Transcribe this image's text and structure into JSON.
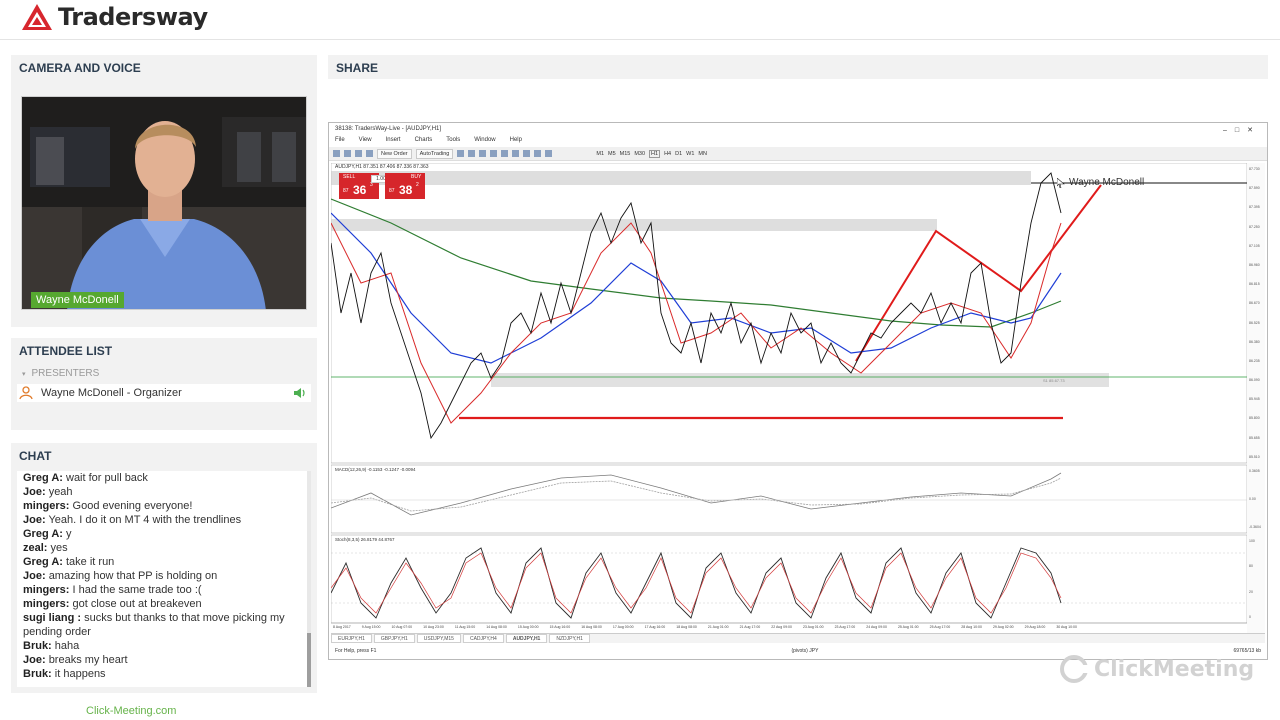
{
  "header": {
    "logo_text": "Tradersway"
  },
  "camera": {
    "title": "CAMERA AND VOICE",
    "presenter_name": "Wayne McDonell"
  },
  "attendees": {
    "title": "ATTENDEE LIST",
    "group_label": "PRESENTERS",
    "items": [
      {
        "name": "Wayne McDonell - Organizer"
      }
    ]
  },
  "chat": {
    "title": "CHAT",
    "messages": [
      {
        "author": "Greg A:",
        "text": "wait for pull back"
      },
      {
        "author": "Joe:",
        "text": "yeah"
      },
      {
        "author": "mingers:",
        "text": "Good evening everyone!"
      },
      {
        "author": "Joe:",
        "text": "Yeah. I do it on MT 4 with the trendlines"
      },
      {
        "author": "Greg A:",
        "text": "y"
      },
      {
        "author": "zeal:",
        "text": "yes"
      },
      {
        "author": "Greg A:",
        "text": "take it run"
      },
      {
        "author": "Joe:",
        "text": "amazing how that PP is holding on"
      },
      {
        "author": "mingers:",
        "text": "I had the same trade too :("
      },
      {
        "author": "mingers:",
        "text": "got close out at breakeven"
      },
      {
        "author": "sugi liang :",
        "text": "sucks but thanks to that move picking my pending order"
      },
      {
        "author": "Bruk:",
        "text": "haha"
      },
      {
        "author": "Joe:",
        "text": "breaks my heart"
      },
      {
        "author": "Bruk:",
        "text": "it happens"
      }
    ]
  },
  "footer": {
    "link": "Click-Meeting.com"
  },
  "share": {
    "title": "SHARE",
    "mt4": {
      "window_title": "38138: TradersWay-Live - [AUDJPY,H1]",
      "menu": [
        "File",
        "View",
        "Insert",
        "Charts",
        "Tools",
        "Window",
        "Help"
      ],
      "toolbar": {
        "new_order": "New Order",
        "autotrading": "AutoTrading"
      },
      "timeframes": [
        "M1",
        "M5",
        "M15",
        "M30",
        "H1",
        "H4",
        "D1",
        "W1",
        "MN"
      ],
      "trade_panel": {
        "sell_label": "SELL",
        "buy_label": "BUY",
        "lot": "1.00",
        "sell_price": "36",
        "sell_prefix": "87",
        "sell_sup": "3",
        "buy_price": "38",
        "buy_prefix": "87",
        "buy_sup": "2"
      },
      "chart_header": "AUDJPY,H1  87.351 87.406 87.336 87.363",
      "presenter_cursor_label": "Wayne McDonell",
      "pivot_label": "S1 85.67.73",
      "macd_label": "MACD(12,26,9) -0.1153 -0.1247 -0.0094",
      "stoch_label": "Stoch(8,3,5) 26.8179 44.8767",
      "x_axis": [
        "8 Aug 2017",
        "9 Aug 15:00",
        "10 Aug 07:00",
        "10 Aug 23:00",
        "11 Aug 15:00",
        "14 Aug 08:00",
        "15 Aug 00:00",
        "15 Aug 16:00",
        "16 Aug 08:00",
        "17 Aug 00:00",
        "17 Aug 16:00",
        "18 Aug 08:00",
        "21 Aug 01:00",
        "21 Aug 17:00",
        "22 Aug 09:00",
        "23 Aug 01:00",
        "23 Aug 17:00",
        "24 Aug 09:00",
        "25 Aug 01:00",
        "25 Aug 17:00",
        "28 Aug 10:00",
        "29 Aug 02:00",
        "29 Aug 18:00",
        "30 Aug 10:00"
      ],
      "price_axis": [
        "87.730",
        "87.590",
        "87.395",
        "87.250",
        "87.105",
        "86.960",
        "86.815",
        "86.670",
        "86.525",
        "86.380",
        "86.235",
        "86.090",
        "85.945",
        "85.800",
        "85.655",
        "85.510"
      ],
      "macd_axis": [
        "0.3605",
        "0.00",
        "-0.3604"
      ],
      "stoch_axis": [
        "100",
        "80",
        "20",
        "0"
      ],
      "tabs": [
        "EURJPY,H1",
        "GBPJPY,H1",
        "USDJPY,M15",
        "CADJPY,H4",
        "AUDJPY,H1",
        "NZDJPY,H1"
      ],
      "status_left": "For Help, press F1",
      "status_mid": "(pivots) JPY",
      "status_right": "69765/13 kb"
    }
  },
  "watermark": "ClickMeeting"
}
